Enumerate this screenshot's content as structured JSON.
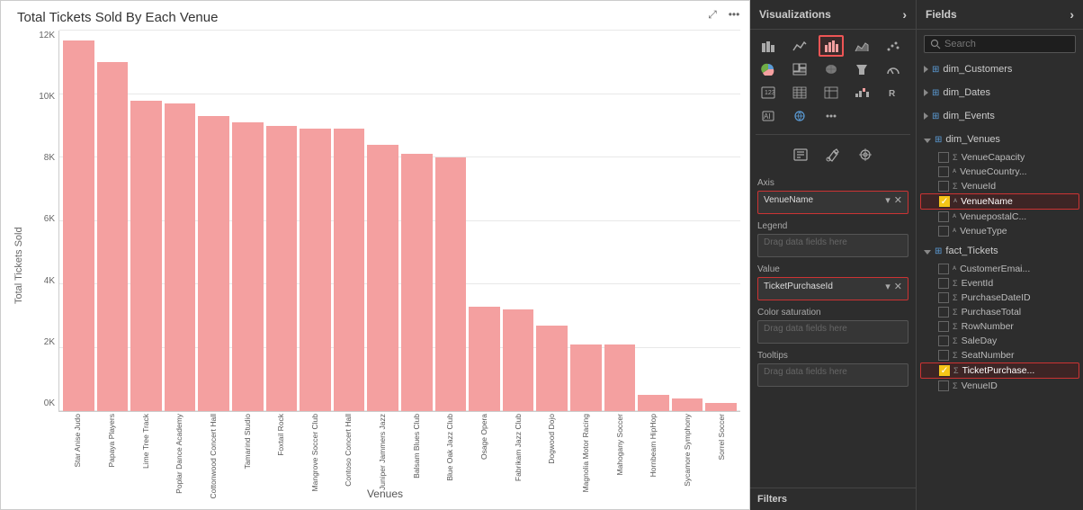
{
  "chart": {
    "title": "Total Tickets Sold By Each Venue",
    "y_axis_label": "Total Tickets Sold",
    "x_axis_label": "Venues",
    "y_ticks": [
      "0K",
      "2K",
      "4K",
      "6K",
      "8K",
      "10K",
      "12K"
    ],
    "bars": [
      {
        "label": "Star Anise Judo",
        "value": 11700,
        "max": 12000
      },
      {
        "label": "Papaya Players",
        "value": 11000,
        "max": 12000
      },
      {
        "label": "Lime Tree Track",
        "value": 9800,
        "max": 12000
      },
      {
        "label": "Poplar Dance Academy",
        "value": 9700,
        "max": 12000
      },
      {
        "label": "Cottonwood Concert Hall",
        "value": 9300,
        "max": 12000
      },
      {
        "label": "Tamarind Studio",
        "value": 9100,
        "max": 12000
      },
      {
        "label": "Foxtail Rock",
        "value": 9000,
        "max": 12000
      },
      {
        "label": "Mangrove Soccer Club",
        "value": 8900,
        "max": 12000
      },
      {
        "label": "Contoso Concert Hall",
        "value": 8900,
        "max": 12000
      },
      {
        "label": "Juniper Jammers Jazz",
        "value": 8400,
        "max": 12000
      },
      {
        "label": "Balsam Blues Club",
        "value": 8100,
        "max": 12000
      },
      {
        "label": "Blue Oak Jazz Club",
        "value": 8000,
        "max": 12000
      },
      {
        "label": "Osage Opera",
        "value": 3300,
        "max": 12000
      },
      {
        "label": "Fabrikam Jazz Club",
        "value": 3200,
        "max": 12000
      },
      {
        "label": "Dogwood Dojo",
        "value": 2700,
        "max": 12000
      },
      {
        "label": "Magnolia Motor Racing",
        "value": 2100,
        "max": 12000
      },
      {
        "label": "Mahogany Soccer",
        "value": 2100,
        "max": 12000
      },
      {
        "label": "Hornbeam HipHop",
        "value": 500,
        "max": 12000
      },
      {
        "label": "Sycamore Symphony",
        "value": 400,
        "max": 12000
      },
      {
        "label": "Sorrel Soccer",
        "value": 250,
        "max": 12000
      }
    ]
  },
  "visualizations": {
    "header": "Visualizations",
    "expand_icon": "›"
  },
  "fields_panel": {
    "header": "Fields",
    "expand_icon": "›",
    "search_placeholder": "Search"
  },
  "field_wells": {
    "axis_label": "Axis",
    "axis_value": "VenueName",
    "legend_label": "Legend",
    "legend_placeholder": "Drag data fields here",
    "value_label": "Value",
    "value_value": "TicketPurchaseId",
    "color_saturation_label": "Color saturation",
    "color_saturation_placeholder": "Drag data fields here",
    "tooltips_label": "Tooltips",
    "tooltips_placeholder": "Drag data fields here"
  },
  "filters": {
    "label": "Filters"
  },
  "field_groups": [
    {
      "name": "dim_Customers",
      "expanded": false,
      "items": []
    },
    {
      "name": "dim_Dates",
      "expanded": false,
      "items": []
    },
    {
      "name": "dim_Events",
      "expanded": false,
      "items": []
    },
    {
      "name": "dim_Venues",
      "expanded": true,
      "items": [
        {
          "name": "VenueCapacity",
          "checked": false,
          "highlighted": false,
          "type": "sigma"
        },
        {
          "name": "VenueCountry...",
          "checked": false,
          "highlighted": false,
          "type": "text"
        },
        {
          "name": "VenueId",
          "checked": false,
          "highlighted": false,
          "type": "sigma"
        },
        {
          "name": "VenueName",
          "checked": true,
          "highlighted": true,
          "type": "text"
        },
        {
          "name": "VenuepostalC...",
          "checked": false,
          "highlighted": false,
          "type": "text"
        },
        {
          "name": "VenueType",
          "checked": false,
          "highlighted": false,
          "type": "text"
        }
      ]
    },
    {
      "name": "fact_Tickets",
      "expanded": true,
      "items": [
        {
          "name": "CustomerEmai...",
          "checked": false,
          "highlighted": false,
          "type": "text"
        },
        {
          "name": "EventId",
          "checked": false,
          "highlighted": false,
          "type": "sigma"
        },
        {
          "name": "PurchaseDateID",
          "checked": false,
          "highlighted": false,
          "type": "sigma"
        },
        {
          "name": "PurchaseTotal",
          "checked": false,
          "highlighted": false,
          "type": "sigma"
        },
        {
          "name": "RowNumber",
          "checked": false,
          "highlighted": false,
          "type": "sigma"
        },
        {
          "name": "SaleDay",
          "checked": false,
          "highlighted": false,
          "type": "sigma"
        },
        {
          "name": "SeatNumber",
          "checked": false,
          "highlighted": false,
          "type": "sigma"
        },
        {
          "name": "TicketPurchase...",
          "checked": true,
          "highlighted": true,
          "type": "sigma"
        },
        {
          "name": "VenueID",
          "checked": false,
          "highlighted": false,
          "type": "sigma"
        }
      ]
    }
  ]
}
